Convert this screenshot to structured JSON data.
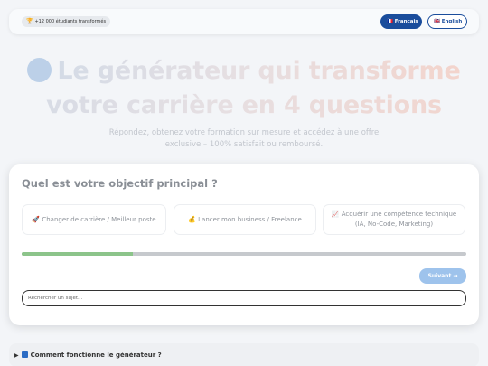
{
  "header": {
    "badge_icon": "trophy-icon",
    "badge_text": "+12 000 étudiants transformés",
    "lang_fr": "🇫🇷 Français",
    "lang_en": "🇬🇧 English"
  },
  "hero": {
    "line1_word1": "Le générateur qui transforme",
    "line2": "votre carrière en 4 questions",
    "subtitle": "Répondez, obtenez votre formation sur mesure et accédez à une offre exclusive – 100% satisfait ou remboursé."
  },
  "quiz": {
    "question": "Quel est votre objectif principal ?",
    "options": [
      "🚀 Changer de carrière / Meilleur poste",
      "💰 Lancer mon business / Freelance",
      "📈 Acquérir une compétence technique (IA, No-Code, Marketing)"
    ],
    "progress": 0.25,
    "next_label": "Suivant →",
    "search_placeholder": "Rechercher un sujet..."
  },
  "faq": {
    "title": "Comment fonctionne le générateur ?"
  },
  "colors": {
    "primary": "#1a4d9c",
    "progress_fill": "#8cc48a",
    "next_button": "#9ec3ec"
  }
}
